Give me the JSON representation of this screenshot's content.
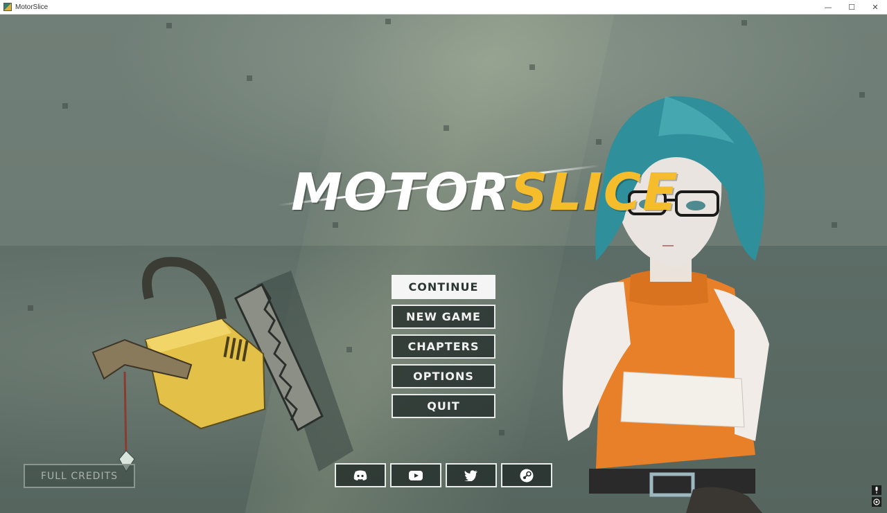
{
  "window": {
    "title": "MotorSlice",
    "controls": {
      "minimize": "—",
      "maximize": "☐",
      "close": "✕"
    }
  },
  "logo": {
    "part1": "MOTOR",
    "part2": "SLICE"
  },
  "menu": {
    "items": [
      {
        "label": "CONTINUE",
        "selected": true
      },
      {
        "label": "NEW GAME",
        "selected": false
      },
      {
        "label": "CHAPTERS",
        "selected": false
      },
      {
        "label": "OPTIONS",
        "selected": false
      },
      {
        "label": "QUIT",
        "selected": false
      }
    ]
  },
  "credits": {
    "label": "FULL CREDITS"
  },
  "socials": [
    {
      "icon": "discord-icon"
    },
    {
      "icon": "youtube-icon"
    },
    {
      "icon": "twitter-icon"
    },
    {
      "icon": "steam-icon"
    }
  ],
  "colors": {
    "accent_yellow": "#f5bc2c",
    "button_border": "#e9ecea",
    "button_bg": "#26302d",
    "hair_teal": "#2f8f9a",
    "outfit_orange": "#e8802a"
  }
}
